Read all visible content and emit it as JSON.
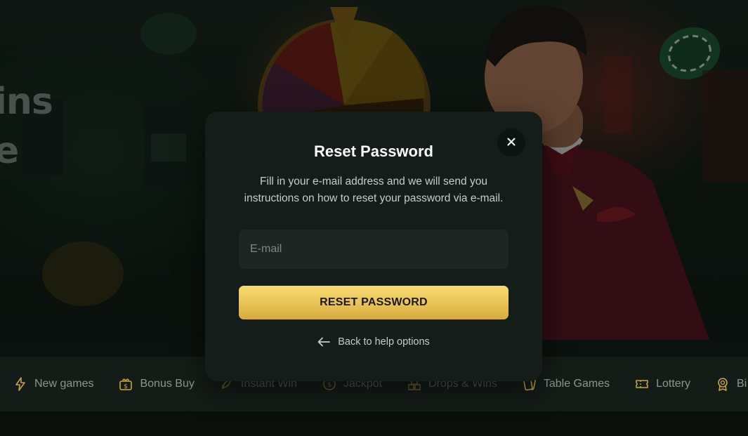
{
  "hero": {
    "title_fragment": "ins\ne"
  },
  "categories": [
    {
      "label": "New games",
      "icon": "lightning-icon",
      "faded": false
    },
    {
      "label": "Bonus Buy",
      "icon": "gift-dollar-icon",
      "faded": false
    },
    {
      "label": "Instant Win",
      "icon": "rocket-icon",
      "faded": true
    },
    {
      "label": "Jackpot",
      "icon": "coin-icon",
      "faded": true
    },
    {
      "label": "Drops & Wins",
      "icon": "stack-icon",
      "faded": true
    },
    {
      "label": "Table Games",
      "icon": "cards-icon",
      "faded": false
    },
    {
      "label": "Lottery",
      "icon": "ticket-icon",
      "faded": false
    },
    {
      "label": "Bi",
      "icon": "badge-icon",
      "faded": false
    }
  ],
  "modal": {
    "title": "Reset Password",
    "description": "Fill in your e-mail address and we will send you instructions on how to reset your password via e-mail.",
    "email_placeholder": "E-mail",
    "email_value": "",
    "submit_label": "RESET PASSWORD",
    "back_label": "Back to help options",
    "close_icon": "close-icon"
  },
  "colors": {
    "accent_gold": "#e8c354",
    "modal_bg": "#151d1a",
    "input_bg": "#1d2623"
  }
}
